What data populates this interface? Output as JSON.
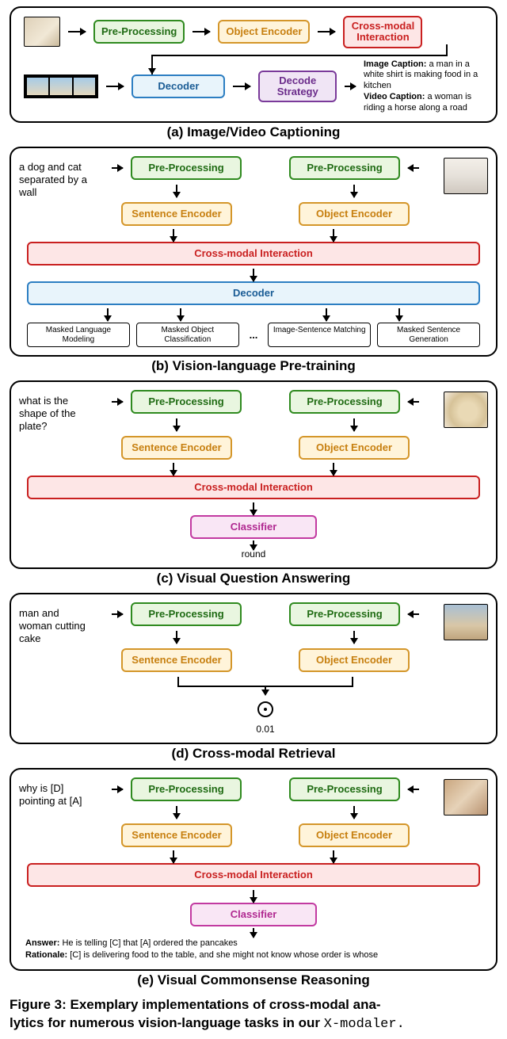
{
  "figure_label": "Figure 3: Exemplary implementations of cross-modal ana-",
  "figure_label_line2": "lytics for numerous vision-language tasks in our ",
  "figure_code": "X-modaler.",
  "panels": {
    "a": {
      "caption": "(a) Image/Video Captioning",
      "pp": "Pre-Processing",
      "oe": "Object Encoder",
      "cmi": "Cross-modal Interaction",
      "dec": "Decoder",
      "ds": "Decode Strategy",
      "out_img_label": "Image Caption:",
      "out_img_text": " a man in a white shirt is making food in a kitchen",
      "out_vid_label": "Video Caption:",
      "out_vid_text": " a woman is riding a horse along a road"
    },
    "b": {
      "caption": "(b) Vision-language Pre-training",
      "input_text": "a dog and cat separated by a wall",
      "pp": "Pre-Processing",
      "se": "Sentence Encoder",
      "oe": "Object Encoder",
      "cmi": "Cross-modal Interaction",
      "dec": "Decoder",
      "tasks": [
        "Masked Language Modeling",
        "Masked Object Classification",
        "...",
        "Image-Sentence Matching",
        "Masked Sentence Generation"
      ]
    },
    "c": {
      "caption": "(c) Visual Question Answering",
      "input_text": "what is the shape of the plate?",
      "pp": "Pre-Processing",
      "se": "Sentence Encoder",
      "oe": "Object Encoder",
      "cmi": "Cross-modal Interaction",
      "cls": "Classifier",
      "out": "round"
    },
    "d": {
      "caption": "(d) Cross-modal Retrieval",
      "input_text": "man and woman cutting cake",
      "pp": "Pre-Processing",
      "se": "Sentence Encoder",
      "oe": "Object Encoder",
      "out": "0.01"
    },
    "e": {
      "caption": "(e) Visual Commonsense Reasoning",
      "input_text": "why is [D] pointing at [A]",
      "pp": "Pre-Processing",
      "se": "Sentence Encoder",
      "oe": "Object Encoder",
      "cmi": "Cross-modal Interaction",
      "cls": "Classifier",
      "answer_label": "Answer:",
      "answer_text": " He is telling [C] that [A] ordered the pancakes",
      "rationale_label": "Rationale:",
      "rationale_text": " [C] is delivering food to the table, and she might not know whose order is whose"
    }
  }
}
